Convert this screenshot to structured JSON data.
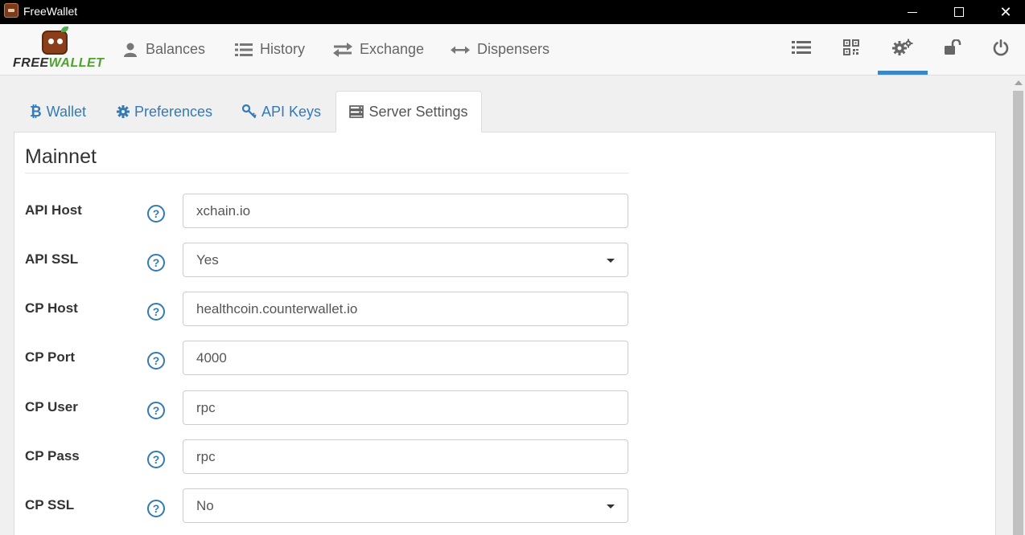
{
  "window": {
    "title": "FreeWallet"
  },
  "logo": {
    "word_a": "FREE",
    "word_b": "WALLET"
  },
  "nav": {
    "balances": "Balances",
    "history": "History",
    "exchange": "Exchange",
    "dispensers": "Dispensers",
    "active_icon": "gears-icon"
  },
  "tabs": {
    "wallet": "Wallet",
    "preferences": "Preferences",
    "api_keys": "API Keys",
    "server_settings": "Server Settings",
    "active": "Server Settings"
  },
  "section": {
    "title": "Mainnet"
  },
  "fields": [
    {
      "label": "API Host",
      "value": "xchain.io",
      "type": "text"
    },
    {
      "label": "API SSL",
      "value": "Yes",
      "type": "select"
    },
    {
      "label": "CP Host",
      "value": "healthcoin.counterwallet.io",
      "type": "text"
    },
    {
      "label": "CP Port",
      "value": "4000",
      "type": "text"
    },
    {
      "label": "CP User",
      "value": "rpc",
      "type": "text"
    },
    {
      "label": "CP Pass",
      "value": "rpc",
      "type": "text"
    },
    {
      "label": "CP SSL",
      "value": "No",
      "type": "select"
    }
  ],
  "help_glyph": "?",
  "colors": {
    "link": "#337ab7",
    "active_underline": "#3a87c8",
    "brand_green": "#4fa22f"
  }
}
